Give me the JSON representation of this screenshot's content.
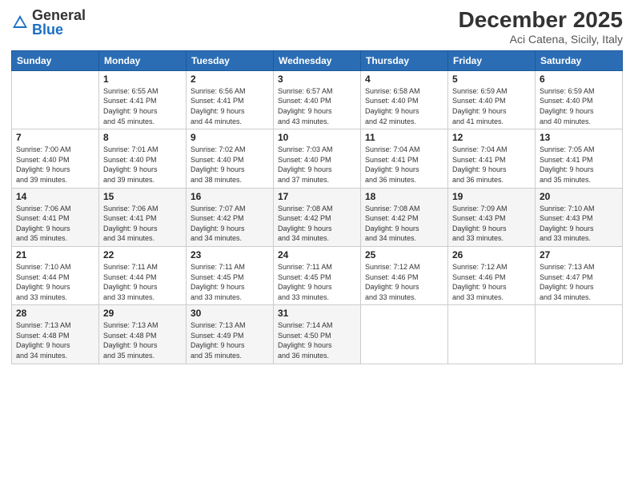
{
  "header": {
    "logo_general": "General",
    "logo_blue": "Blue",
    "main_title": "December 2025",
    "subtitle": "Aci Catena, Sicily, Italy"
  },
  "columns": [
    "Sunday",
    "Monday",
    "Tuesday",
    "Wednesday",
    "Thursday",
    "Friday",
    "Saturday"
  ],
  "weeks": [
    [
      {
        "day": "",
        "info": ""
      },
      {
        "day": "1",
        "info": "Sunrise: 6:55 AM\nSunset: 4:41 PM\nDaylight: 9 hours\nand 45 minutes."
      },
      {
        "day": "2",
        "info": "Sunrise: 6:56 AM\nSunset: 4:41 PM\nDaylight: 9 hours\nand 44 minutes."
      },
      {
        "day": "3",
        "info": "Sunrise: 6:57 AM\nSunset: 4:40 PM\nDaylight: 9 hours\nand 43 minutes."
      },
      {
        "day": "4",
        "info": "Sunrise: 6:58 AM\nSunset: 4:40 PM\nDaylight: 9 hours\nand 42 minutes."
      },
      {
        "day": "5",
        "info": "Sunrise: 6:59 AM\nSunset: 4:40 PM\nDaylight: 9 hours\nand 41 minutes."
      },
      {
        "day": "6",
        "info": "Sunrise: 6:59 AM\nSunset: 4:40 PM\nDaylight: 9 hours\nand 40 minutes."
      }
    ],
    [
      {
        "day": "7",
        "info": "Sunrise: 7:00 AM\nSunset: 4:40 PM\nDaylight: 9 hours\nand 39 minutes."
      },
      {
        "day": "8",
        "info": "Sunrise: 7:01 AM\nSunset: 4:40 PM\nDaylight: 9 hours\nand 39 minutes."
      },
      {
        "day": "9",
        "info": "Sunrise: 7:02 AM\nSunset: 4:40 PM\nDaylight: 9 hours\nand 38 minutes."
      },
      {
        "day": "10",
        "info": "Sunrise: 7:03 AM\nSunset: 4:40 PM\nDaylight: 9 hours\nand 37 minutes."
      },
      {
        "day": "11",
        "info": "Sunrise: 7:04 AM\nSunset: 4:41 PM\nDaylight: 9 hours\nand 36 minutes."
      },
      {
        "day": "12",
        "info": "Sunrise: 7:04 AM\nSunset: 4:41 PM\nDaylight: 9 hours\nand 36 minutes."
      },
      {
        "day": "13",
        "info": "Sunrise: 7:05 AM\nSunset: 4:41 PM\nDaylight: 9 hours\nand 35 minutes."
      }
    ],
    [
      {
        "day": "14",
        "info": "Sunrise: 7:06 AM\nSunset: 4:41 PM\nDaylight: 9 hours\nand 35 minutes."
      },
      {
        "day": "15",
        "info": "Sunrise: 7:06 AM\nSunset: 4:41 PM\nDaylight: 9 hours\nand 34 minutes."
      },
      {
        "day": "16",
        "info": "Sunrise: 7:07 AM\nSunset: 4:42 PM\nDaylight: 9 hours\nand 34 minutes."
      },
      {
        "day": "17",
        "info": "Sunrise: 7:08 AM\nSunset: 4:42 PM\nDaylight: 9 hours\nand 34 minutes."
      },
      {
        "day": "18",
        "info": "Sunrise: 7:08 AM\nSunset: 4:42 PM\nDaylight: 9 hours\nand 34 minutes."
      },
      {
        "day": "19",
        "info": "Sunrise: 7:09 AM\nSunset: 4:43 PM\nDaylight: 9 hours\nand 33 minutes."
      },
      {
        "day": "20",
        "info": "Sunrise: 7:10 AM\nSunset: 4:43 PM\nDaylight: 9 hours\nand 33 minutes."
      }
    ],
    [
      {
        "day": "21",
        "info": "Sunrise: 7:10 AM\nSunset: 4:44 PM\nDaylight: 9 hours\nand 33 minutes."
      },
      {
        "day": "22",
        "info": "Sunrise: 7:11 AM\nSunset: 4:44 PM\nDaylight: 9 hours\nand 33 minutes."
      },
      {
        "day": "23",
        "info": "Sunrise: 7:11 AM\nSunset: 4:45 PM\nDaylight: 9 hours\nand 33 minutes."
      },
      {
        "day": "24",
        "info": "Sunrise: 7:11 AM\nSunset: 4:45 PM\nDaylight: 9 hours\nand 33 minutes."
      },
      {
        "day": "25",
        "info": "Sunrise: 7:12 AM\nSunset: 4:46 PM\nDaylight: 9 hours\nand 33 minutes."
      },
      {
        "day": "26",
        "info": "Sunrise: 7:12 AM\nSunset: 4:46 PM\nDaylight: 9 hours\nand 33 minutes."
      },
      {
        "day": "27",
        "info": "Sunrise: 7:13 AM\nSunset: 4:47 PM\nDaylight: 9 hours\nand 34 minutes."
      }
    ],
    [
      {
        "day": "28",
        "info": "Sunrise: 7:13 AM\nSunset: 4:48 PM\nDaylight: 9 hours\nand 34 minutes."
      },
      {
        "day": "29",
        "info": "Sunrise: 7:13 AM\nSunset: 4:48 PM\nDaylight: 9 hours\nand 35 minutes."
      },
      {
        "day": "30",
        "info": "Sunrise: 7:13 AM\nSunset: 4:49 PM\nDaylight: 9 hours\nand 35 minutes."
      },
      {
        "day": "31",
        "info": "Sunrise: 7:14 AM\nSunset: 4:50 PM\nDaylight: 9 hours\nand 36 minutes."
      },
      {
        "day": "",
        "info": ""
      },
      {
        "day": "",
        "info": ""
      },
      {
        "day": "",
        "info": ""
      }
    ]
  ]
}
